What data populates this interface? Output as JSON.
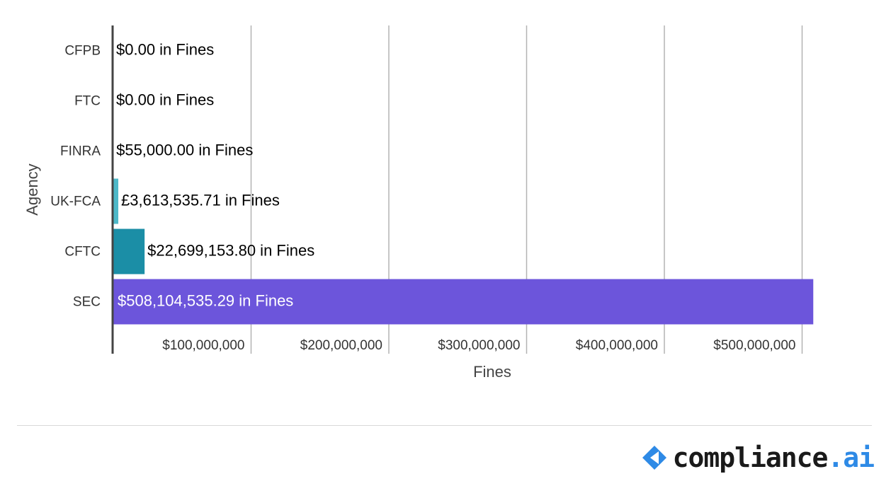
{
  "chart_data": {
    "type": "bar",
    "orientation": "horizontal",
    "categories": [
      "CFPB",
      "FTC",
      "FINRA",
      "UK-FCA",
      "CFTC",
      "SEC"
    ],
    "values": [
      0,
      0,
      55000,
      3613535.71,
      22699153.8,
      508104535.29
    ],
    "data_labels": [
      "$0.00 in Fines",
      "$0.00 in Fines",
      "$55,000.00 in Fines",
      "£3,613,535.71 in Fines",
      "$22,699,153.80 in Fines",
      "$508,104,535.29 in Fines"
    ],
    "bar_colors": [
      "#4db8c8",
      "#4db8c8",
      "#4db8c8",
      "#4db8c8",
      "#1b8ea6",
      "#6c55db"
    ],
    "x_ticks": [
      100000000,
      200000000,
      300000000,
      400000000,
      500000000
    ],
    "x_tick_labels": [
      "$100,000,000",
      "$200,000,000",
      "$300,000,000",
      "$400,000,000",
      "$500,000,000"
    ],
    "xlim": [
      0,
      509000000
    ],
    "xlabel": "Fines",
    "ylabel": "Agency",
    "grid": true,
    "legend": "none"
  },
  "logo": {
    "text_main": "compliance",
    "text_accent": ".ai",
    "mark_color": "#2e8ae6",
    "icon": "chevron-diamond-icon"
  }
}
